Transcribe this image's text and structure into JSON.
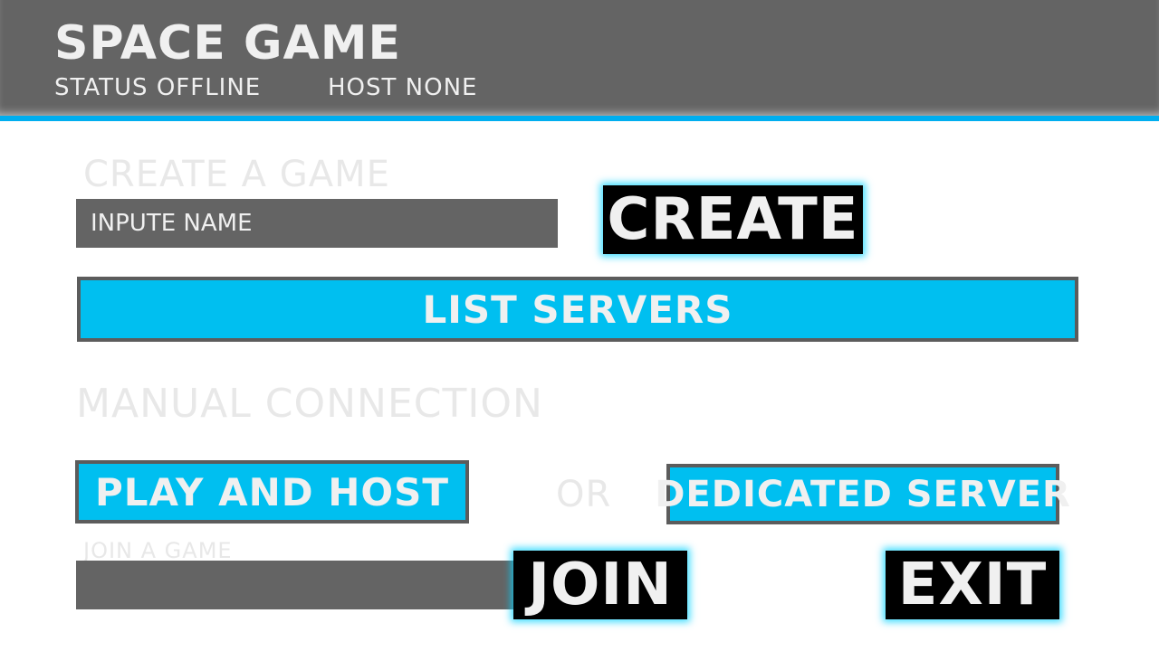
{
  "header": {
    "title": "SPACE GAME",
    "status": "STATUS OFFLINE",
    "host": "HOST NONE"
  },
  "create": {
    "heading": "CREATE A GAME",
    "name_placeholder": "INPUTE NAME",
    "button_label": "CREATE"
  },
  "list_servers_label": "LIST SERVERS",
  "manual": {
    "heading": "MANUAL CONNECTION",
    "play_and_host_label": "PLAY AND HOST",
    "or_label": "OR",
    "dedicated_server_label": "DEDICATED SERVER"
  },
  "join": {
    "heading": "JOIN A GAME",
    "input_value": "",
    "button_label": "JOIN"
  },
  "exit_label": "EXIT",
  "colors": {
    "bar_gray": "#646464",
    "accent_blue": "#00bff0",
    "button_black": "#000000",
    "glow_cyan": "#00d2ff"
  }
}
